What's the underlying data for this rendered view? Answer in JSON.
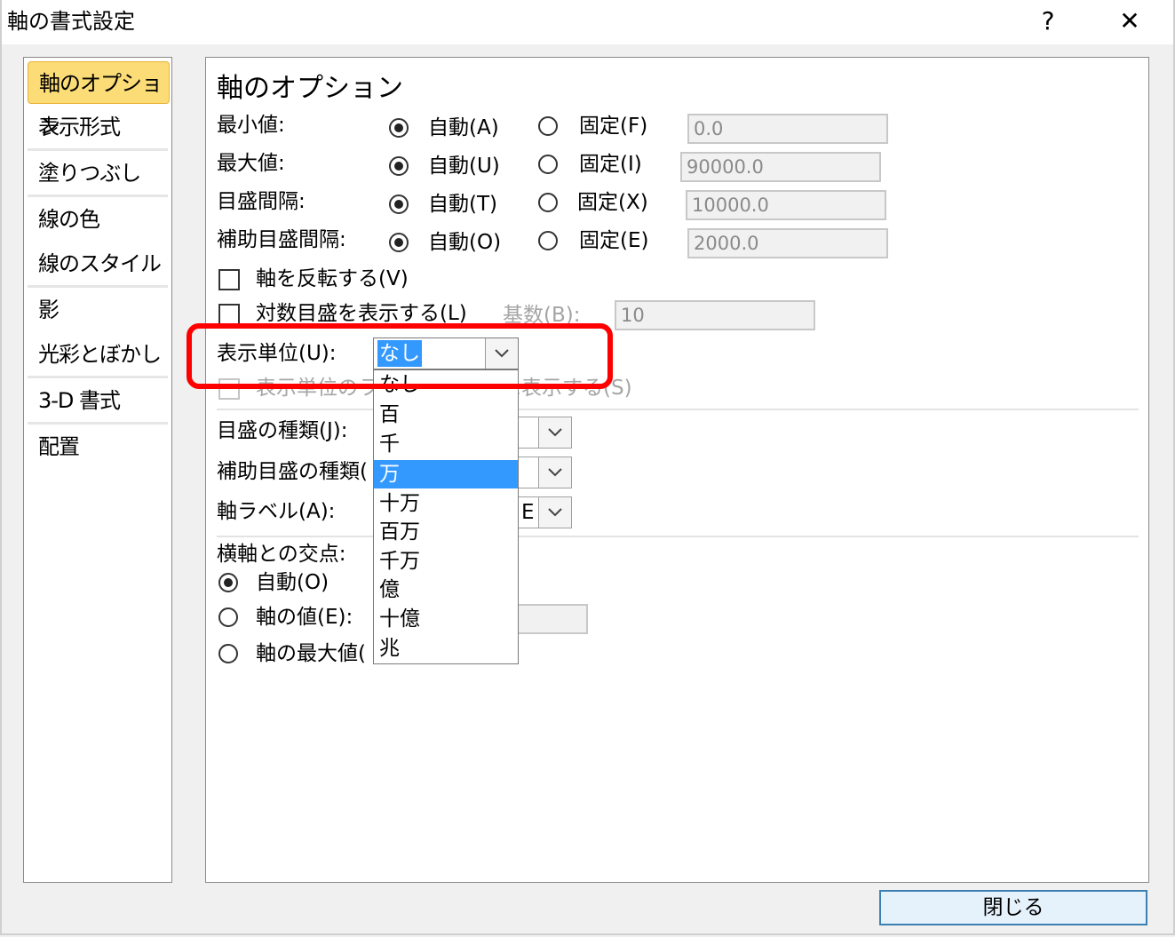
{
  "window": {
    "title": "軸の書式設定",
    "help_label": "?",
    "close_label": "✕"
  },
  "sidebar": {
    "items": [
      {
        "label": "軸のオプション"
      },
      {
        "label": "表示形式"
      },
      {
        "label": "塗りつぶし"
      },
      {
        "label": "線の色"
      },
      {
        "label": "線のスタイル"
      },
      {
        "label": "影"
      },
      {
        "label": "光彩とぼかし"
      },
      {
        "label": "3-D 書式"
      },
      {
        "label": "配置"
      }
    ]
  },
  "axis_options": {
    "heading": "軸のオプション",
    "rows": [
      {
        "label": "最小値:",
        "auto": "自動(A)",
        "fixed": "固定(F)",
        "value": "0.0"
      },
      {
        "label": "最大値:",
        "auto": "自動(U)",
        "fixed": "固定(I)",
        "value": "90000.0"
      },
      {
        "label": "目盛間隔:",
        "auto": "自動(T)",
        "fixed": "固定(X)",
        "value": "10000.0"
      },
      {
        "label": "補助目盛間隔:",
        "auto": "自動(O)",
        "fixed": "固定(E)",
        "value": "2000.0"
      }
    ],
    "reverse_axis": "軸を反転する(V)",
    "log_scale": "対数目盛を表示する(L)",
    "log_base_label": "基数(B):",
    "log_base_value": "10",
    "display_unit_label": "表示単位(U):",
    "display_unit_value": "なし",
    "show_unit_label": "表示単位のラベルをグラフに表示する(S)",
    "tick_type_label": "目盛の種類(J):",
    "minor_tick_type_label": "補助目盛の種類(",
    "axis_label_label": "軸ラベル(A):",
    "axis_label_tail": "E",
    "cross_label": "横軸との交点:",
    "cross_auto": "自動(O)",
    "cross_value": "軸の値(E):",
    "cross_max": "軸の最大値("
  },
  "dropdown": {
    "options": [
      "なし",
      "百",
      "千",
      "万",
      "十万",
      "百万",
      "千万",
      "億",
      "十億",
      "兆"
    ],
    "highlighted": "万"
  },
  "footer": {
    "close_button": "閉じる"
  }
}
